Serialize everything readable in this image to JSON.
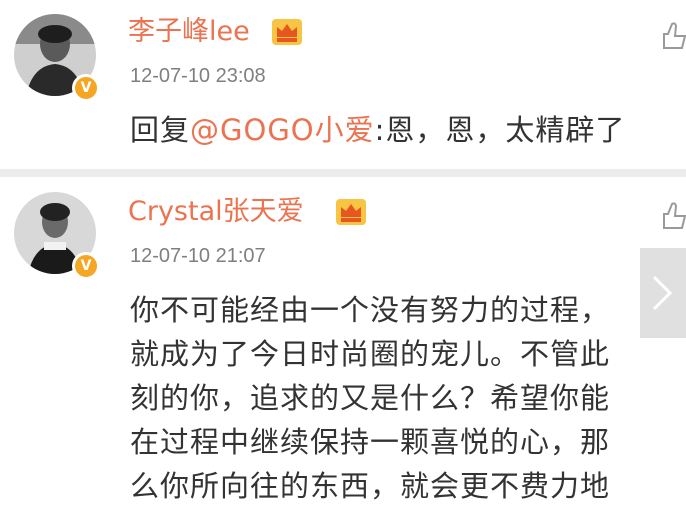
{
  "comments": [
    {
      "username": "李子峰lee",
      "timestamp": "12-07-10 23:08",
      "reply_prefix": "回复",
      "mention": "@GOGO小爱",
      "text": ":恩，恩，太精辟了"
    },
    {
      "username": "Crystal张天爱",
      "timestamp": "12-07-10 21:07",
      "lines": [
        "你不可能经由一个没有努力的过程，",
        "就成为了今日时尚圈的宠儿。不管此",
        "刻的你，追求的又是什么？希望你能",
        "在过程中继续保持一颗喜悦的心，那",
        "么你所向往的东西，就会更不费力地"
      ]
    }
  ],
  "badge_letter": "V",
  "colors": {
    "username": "#eb7350",
    "timestamp": "#7f7f7f",
    "body_text": "#333333",
    "verified_badge": "#f5a623"
  },
  "icons": [
    "vip-crown-icon",
    "like-icon",
    "verified-badge-icon",
    "chevron-right-icon"
  ]
}
